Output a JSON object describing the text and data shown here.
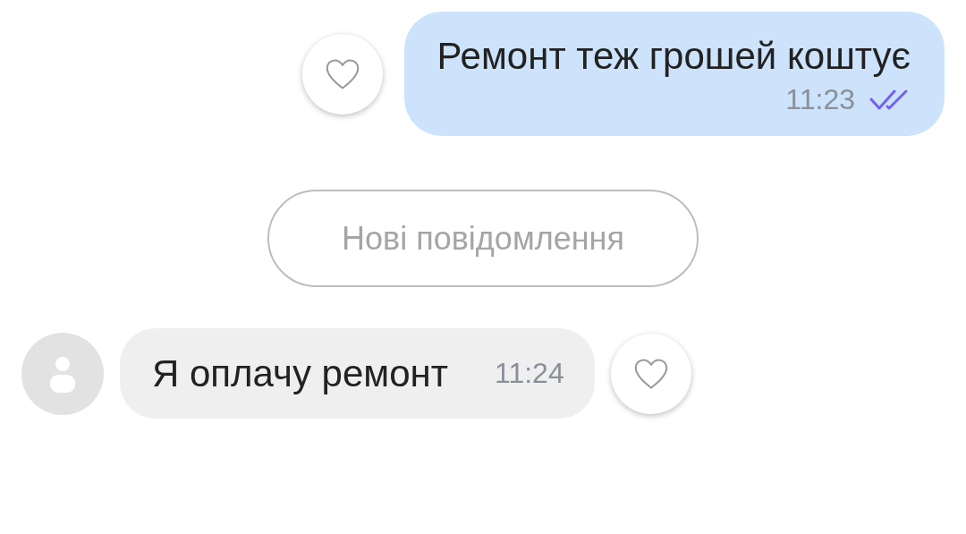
{
  "messages": [
    {
      "kind": "outgoing",
      "text": "Ремонт теж грошей коштує",
      "time": "11:23",
      "read": true,
      "liked": false
    },
    {
      "kind": "divider",
      "text": "Нові повідомлення"
    },
    {
      "kind": "incoming",
      "text": "Я оплачу ремонт",
      "time": "11:24",
      "liked": false
    }
  ]
}
